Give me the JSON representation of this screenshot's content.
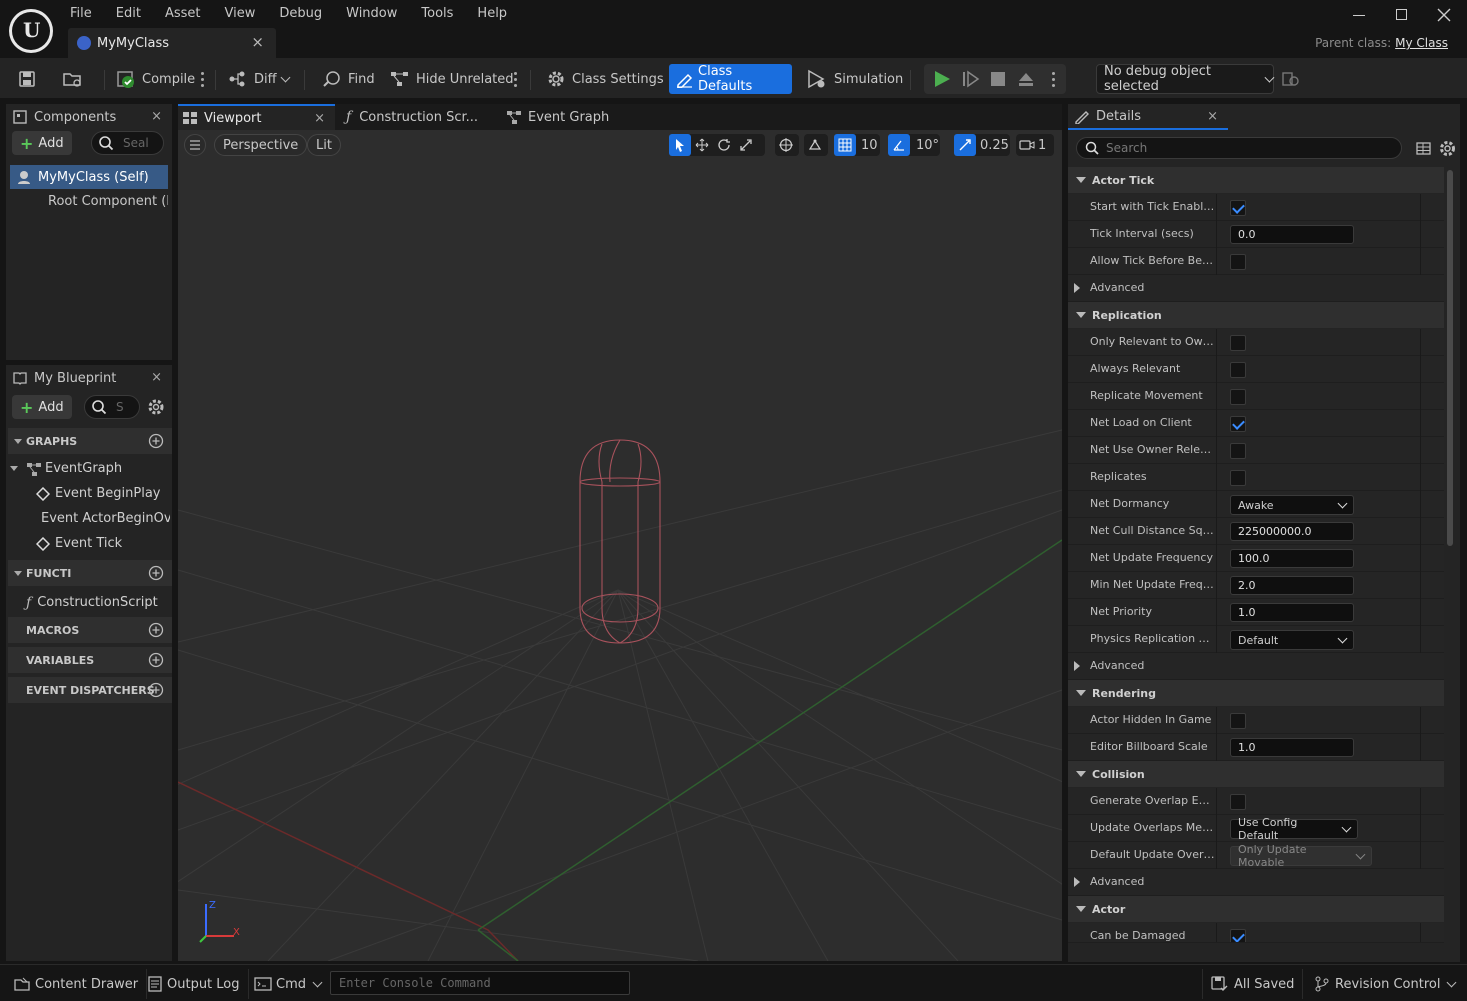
{
  "window": {
    "menu": [
      "File",
      "Edit",
      "Asset",
      "View",
      "Debug",
      "Window",
      "Tools",
      "Help"
    ],
    "doc_tab": "MyMyClass",
    "parent_class_label": "Parent class:",
    "parent_class_value": "My Class",
    "close_glyph": "×"
  },
  "toolbar": {
    "compile": "Compile",
    "diff": "Diff",
    "find": "Find",
    "hide_unrelated": "Hide Unrelated",
    "class_settings": "Class Settings",
    "class_defaults": "Class Defaults",
    "simulation": "Simulation",
    "debug_object": "No debug object selected"
  },
  "components": {
    "title": "Components",
    "add": "Add",
    "search_placeholder": "Seal",
    "items": [
      "MyMyClass (Self)",
      "Root Component (I"
    ]
  },
  "my_blueprint": {
    "title": "My Blueprint",
    "add": "Add",
    "search_placeholder": "S",
    "graphs_header": "GRAPHS",
    "graphs": [
      "EventGraph",
      "Event BeginPlay",
      "Event ActorBeginOv",
      "Event Tick"
    ],
    "functions_header": "FUNCTI",
    "functions": [
      "ConstructionScript"
    ],
    "macros_header": "MACROS",
    "variables_header": "VARIABLES",
    "dispatchers_header": "EVENT DISPATCHERS"
  },
  "editor_tabs": [
    "Viewport",
    "Construction Scr...",
    "Event Graph"
  ],
  "viewport": {
    "perspective": "Perspective",
    "lit": "Lit",
    "grid_snap": "10",
    "rot_snap": "10°",
    "scale_snap": "0.25",
    "camera_speed": "1",
    "axis_x": "X",
    "axis_z": "Z"
  },
  "details": {
    "title": "Details",
    "search_placeholder": "Search",
    "sections": {
      "actor_tick": "Actor Tick",
      "replication": "Replication",
      "rendering": "Rendering",
      "collision": "Collision",
      "actor": "Actor"
    },
    "advanced": "Advanced",
    "rows": {
      "start_tick": {
        "name": "Start with Tick Enabled",
        "checked": true
      },
      "tick_interval": {
        "name": "Tick Interval (secs)",
        "value": "0.0"
      },
      "allow_tick": {
        "name": "Allow Tick Before Begi...",
        "checked": false
      },
      "only_relevant": {
        "name": "Only Relevant to Owner",
        "checked": false
      },
      "always_relevant": {
        "name": "Always Relevant",
        "checked": false
      },
      "replicate_movement": {
        "name": "Replicate Movement",
        "checked": false
      },
      "net_load": {
        "name": "Net Load on Client",
        "checked": true
      },
      "net_use_owner": {
        "name": "Net Use Owner Relevan...",
        "checked": false
      },
      "replicates": {
        "name": "Replicates",
        "checked": false
      },
      "net_dormancy": {
        "name": "Net Dormancy",
        "value": "Awake"
      },
      "net_cull": {
        "name": "Net Cull Distance Squa...",
        "value": "225000000.0"
      },
      "net_update_freq": {
        "name": "Net Update Frequency",
        "value": "100.0"
      },
      "min_net_update": {
        "name": "Min Net Update Freque...",
        "value": "2.0"
      },
      "net_priority": {
        "name": "Net Priority",
        "value": "1.0"
      },
      "physics_rep": {
        "name": "Physics Replication Mo...",
        "value": "Default"
      },
      "actor_hidden": {
        "name": "Actor Hidden In Game",
        "checked": false
      },
      "billboard_scale": {
        "name": "Editor Billboard Scale",
        "value": "1.0"
      },
      "gen_overlap": {
        "name": "Generate Overlap Event...",
        "checked": false
      },
      "update_overlaps": {
        "name": "Update Overlaps Metho...",
        "value": "Use Config Default"
      },
      "default_update_overlap": {
        "name": "Default Update Overlap...",
        "value": "Only Update Movable"
      },
      "can_be_damaged": {
        "name": "Can be Damaged",
        "checked": true
      }
    }
  },
  "statusbar": {
    "content_drawer": "Content Drawer",
    "output_log": "Output Log",
    "cmd": "Cmd",
    "console_placeholder": "Enter Console Command",
    "all_saved": "All Saved",
    "revision_control": "Revision Control"
  },
  "colors": {
    "accent": "#1a6ede",
    "play": "#4caf50",
    "capsule": "#a8525c"
  }
}
